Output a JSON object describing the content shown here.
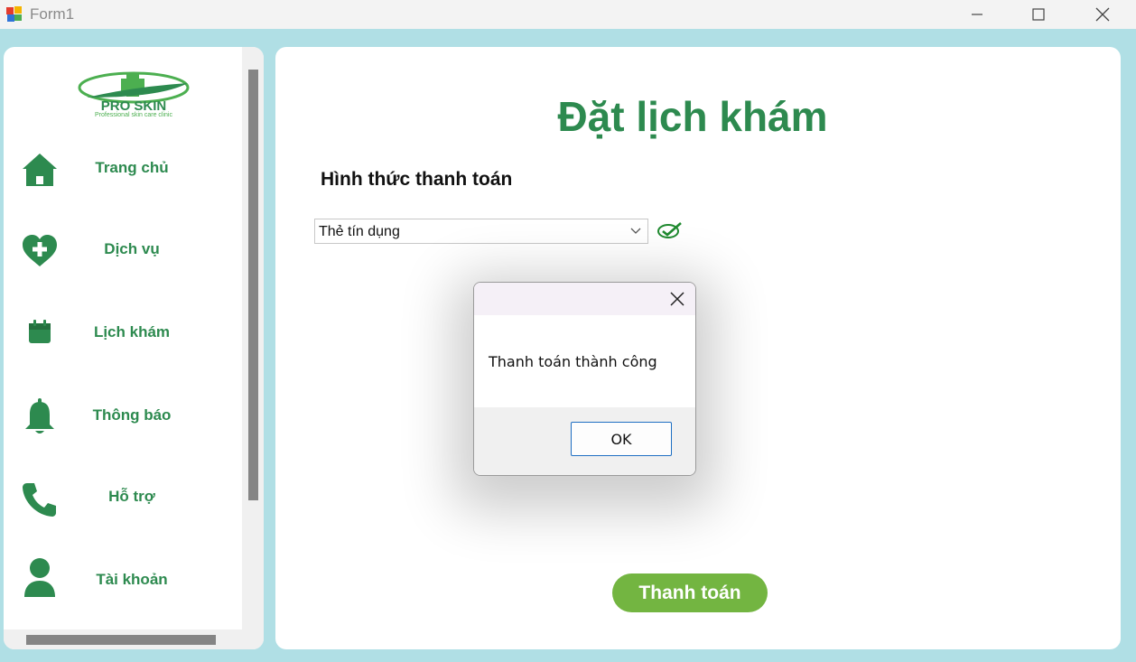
{
  "window": {
    "title": "Form1"
  },
  "logo": {
    "brand": "PRO SKIN",
    "tagline": "Professional skin care clinic"
  },
  "sidebar": {
    "items": [
      {
        "label": "Trang chủ",
        "icon": "home-icon"
      },
      {
        "label": "Dịch vụ",
        "icon": "heart-plus-icon"
      },
      {
        "label": "Lịch khám",
        "icon": "calendar-icon"
      },
      {
        "label": "Thông báo",
        "icon": "bell-icon"
      },
      {
        "label": "Hỗ trợ",
        "icon": "phone-icon"
      },
      {
        "label": "Tài khoản",
        "icon": "user-icon"
      }
    ]
  },
  "main": {
    "title": "Đặt lịch khám",
    "payment_label": "Hình thức thanh toán",
    "payment_method": "Thẻ tín dụng",
    "pay_button": "Thanh toán"
  },
  "dialog": {
    "message": "Thanh toán thành công",
    "ok_label": "OK"
  },
  "colors": {
    "brand_green": "#2d8a4f",
    "button_green": "#73b541",
    "background_teal": "#b0dfe5"
  }
}
